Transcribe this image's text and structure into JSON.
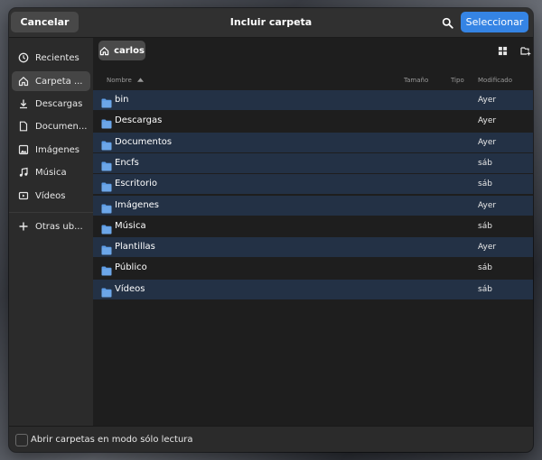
{
  "header": {
    "cancel_label": "Cancelar",
    "title": "Incluir carpeta",
    "select_label": "Seleccionar"
  },
  "sidebar": {
    "items": [
      {
        "label": "Recientes",
        "icon": "clock-icon"
      },
      {
        "label": "Carpeta ...",
        "icon": "home-icon"
      },
      {
        "label": "Descargas",
        "icon": "download-icon"
      },
      {
        "label": "Documen...",
        "icon": "document-icon"
      },
      {
        "label": "Imágenes",
        "icon": "image-icon"
      },
      {
        "label": "Música",
        "icon": "music-icon"
      },
      {
        "label": "Vídeos",
        "icon": "video-icon"
      }
    ],
    "other_locations": "Otras ub..."
  },
  "pathbar": {
    "current": "carlos"
  },
  "columns": {
    "name": "Nombre",
    "size": "Tamaño",
    "type": "Tipo",
    "modified": "Modificado"
  },
  "files": [
    {
      "name": "bin",
      "modified": "Ayer",
      "selected": true
    },
    {
      "name": "Descargas",
      "modified": "Ayer",
      "selected": false
    },
    {
      "name": "Documentos",
      "modified": "Ayer",
      "selected": true
    },
    {
      "name": "Encfs",
      "modified": "sáb",
      "selected": true
    },
    {
      "name": "Escritorio",
      "modified": "sáb",
      "selected": true
    },
    {
      "name": "Imágenes",
      "modified": "Ayer",
      "selected": true
    },
    {
      "name": "Música",
      "modified": "sáb",
      "selected": false
    },
    {
      "name": "Plantillas",
      "modified": "Ayer",
      "selected": true
    },
    {
      "name": "Público",
      "modified": "sáb",
      "selected": false
    },
    {
      "name": "Vídeos",
      "modified": "sáb",
      "selected": true
    }
  ],
  "footer": {
    "readonly_label": "Abrir carpetas en modo sólo lectura",
    "readonly_checked": false
  },
  "colors": {
    "accent": "#3584e4",
    "selection": "#233145",
    "folder": "#5e9de6"
  }
}
